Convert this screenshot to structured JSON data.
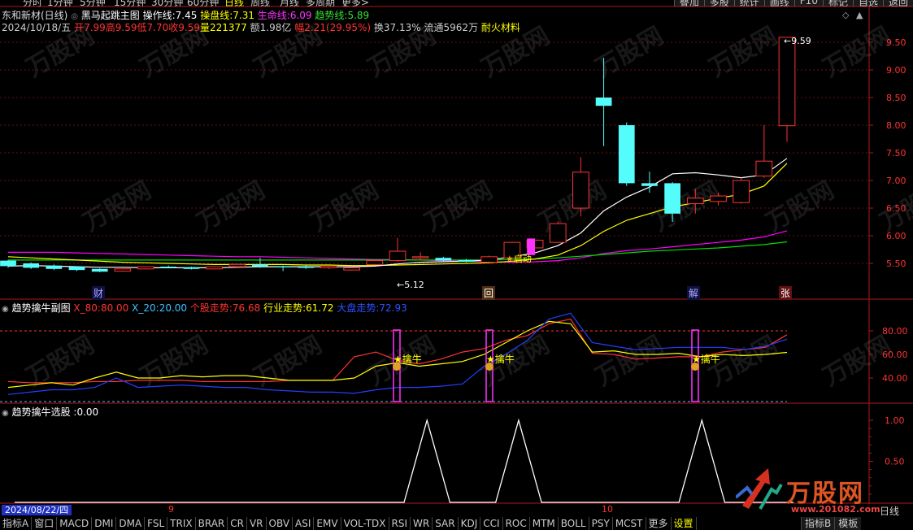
{
  "top_tabs": [
    "分时",
    "1分钟",
    "5分钟",
    "15分钟",
    "30分钟",
    "60分钟",
    "日线",
    "周线",
    "月线",
    "多周期",
    "更多>"
  ],
  "top_active": "日线",
  "top_right_buttons": [
    "叠加",
    "多股",
    "统计",
    "画线",
    "F10",
    "标记",
    "自选",
    "返回"
  ],
  "main_panel": {
    "stock_name": "东和新材(日线)",
    "indicator_name": "黑马起跳主图",
    "op_line_label": "操作线:",
    "op_line_value": "7.45",
    "trade_line_label": "操盘线:",
    "trade_line_value": "7.31",
    "life_line_label": "生命线:",
    "life_line_value": "6.09",
    "trend_line_label": "趋势线:",
    "trend_line_value": "5.89",
    "date": "2024/10/18/五",
    "open_label": "开",
    "open": "7.99",
    "high_label": "高",
    "high": "9.59",
    "low_label": "低",
    "low": "7.70",
    "close_label": "收",
    "close": "9.59",
    "vol_label": "量",
    "vol": "221377",
    "amount_label": "额",
    "amount": "1.98亿",
    "change_label": "幅",
    "change": "2.21(29.95%)",
    "turnover_label": "换",
    "turnover": "37.13%",
    "float_label": "流通",
    "float": "5962万",
    "sector": "耐火材料",
    "high_mark": "9.59",
    "low_mark": "5.12",
    "start_label": "启动",
    "markers": [
      "财",
      "回",
      "解",
      "张"
    ]
  },
  "sub1": {
    "title": "趋势擒牛副图",
    "x80_label": "X_80:",
    "x80": "80.00",
    "x20_label": "X_20:",
    "x20": "20.00",
    "stock_label": "个股走势:",
    "stock": "76.68",
    "industry_label": "行业走势:",
    "industry": "61.72",
    "market_label": "大盘走势:",
    "market": "72.93",
    "signal_label": "擒牛"
  },
  "sub2": {
    "title": "趋势擒牛选股",
    "value_sep": ":",
    "value": "0.00"
  },
  "axes": {
    "main": [
      "9.50",
      "9.00",
      "8.50",
      "8.00",
      "7.50",
      "7.00",
      "6.50",
      "6.00",
      "5.50"
    ],
    "sub1": [
      "80.00",
      "60.00",
      "40.00"
    ],
    "sub2": [
      "1.00",
      "0.50"
    ]
  },
  "time_axis": {
    "start_date": "2024/08/22/四",
    "month1": "9",
    "month2": "10",
    "period": "日线"
  },
  "bottom_tabs": [
    "指标A",
    "窗口",
    "MACD",
    "DMI",
    "DMA",
    "FSL",
    "TRIX",
    "BRAR",
    "CR",
    "VR",
    "OBV",
    "ASI",
    "EMV",
    "VOL-TDX",
    "RSI",
    "WR",
    "SAR",
    "KDJ",
    "CCI",
    "ROC",
    "MTM",
    "BOLL",
    "PSY",
    "MCST",
    "更多",
    "设置"
  ],
  "bottom_active": "设置",
  "bottom_right_tabs": [
    "指标B",
    "模板"
  ],
  "watermark": {
    "brand": "万股网",
    "url": "www.201082.com"
  },
  "colors": {
    "up": "#ff3333",
    "down": "#54fcfc",
    "ma1": "#ffffff",
    "ma2": "#ffff00",
    "ma3": "#ff00ff",
    "ma4": "#00e000"
  },
  "chart_data": [
    {
      "type": "candlestick",
      "title": "黑马起跳主图",
      "ylim": [
        5.1,
        9.8
      ],
      "candles": [
        {
          "o": 5.55,
          "c": 5.45,
          "h": 5.56,
          "l": 5.42
        },
        {
          "o": 5.5,
          "c": 5.42,
          "h": 5.52,
          "l": 5.4
        },
        {
          "o": 5.46,
          "c": 5.4,
          "h": 5.48,
          "l": 5.38
        },
        {
          "o": 5.44,
          "c": 5.38,
          "h": 5.45,
          "l": 5.36
        },
        {
          "o": 5.4,
          "c": 5.35,
          "h": 5.41,
          "l": 5.34
        },
        {
          "o": 5.36,
          "c": 5.4,
          "h": 5.41,
          "l": 5.35
        },
        {
          "o": 5.4,
          "c": 5.44,
          "h": 5.45,
          "l": 5.39
        },
        {
          "o": 5.44,
          "c": 5.42,
          "h": 5.46,
          "l": 5.41
        },
        {
          "o": 5.43,
          "c": 5.4,
          "h": 5.44,
          "l": 5.39
        },
        {
          "o": 5.4,
          "c": 5.44,
          "h": 5.45,
          "l": 5.39
        },
        {
          "o": 5.44,
          "c": 5.48,
          "h": 5.49,
          "l": 5.43
        },
        {
          "o": 5.48,
          "c": 5.44,
          "h": 5.6,
          "l": 5.42
        },
        {
          "o": 5.45,
          "c": 5.44,
          "h": 5.46,
          "l": 5.36
        },
        {
          "o": 5.44,
          "c": 5.42,
          "h": 5.46,
          "l": 5.4
        },
        {
          "o": 5.42,
          "c": 5.45,
          "h": 5.46,
          "l": 5.4
        },
        {
          "o": 5.38,
          "c": 5.42,
          "h": 5.43,
          "l": 5.37
        },
        {
          "o": 5.48,
          "c": 5.55,
          "h": 5.56,
          "l": 5.47
        },
        {
          "o": 5.55,
          "c": 5.72,
          "h": 5.96,
          "l": 5.53
        },
        {
          "o": 5.62,
          "c": 5.62,
          "h": 5.7,
          "l": 5.55
        },
        {
          "o": 5.6,
          "c": 5.55,
          "h": 5.62,
          "l": 5.54
        },
        {
          "o": 5.56,
          "c": 5.53,
          "h": 5.58,
          "l": 5.52
        },
        {
          "o": 5.52,
          "c": 5.62,
          "h": 5.64,
          "l": 5.51
        },
        {
          "o": 5.6,
          "c": 5.88,
          "h": 5.89,
          "l": 5.59
        },
        {
          "o": 5.78,
          "c": 5.92,
          "h": 5.93,
          "l": 5.77
        },
        {
          "o": 5.88,
          "c": 6.22,
          "h": 6.26,
          "l": 5.87
        },
        {
          "o": 6.5,
          "c": 7.15,
          "h": 7.42,
          "l": 6.35
        },
        {
          "o": 8.5,
          "c": 8.35,
          "h": 9.22,
          "l": 7.62
        },
        {
          "o": 8.0,
          "c": 6.95,
          "h": 8.05,
          "l": 6.9
        },
        {
          "o": 6.95,
          "c": 6.9,
          "h": 7.16,
          "l": 6.78
        },
        {
          "o": 6.95,
          "c": 6.4,
          "h": 6.97,
          "l": 6.25
        },
        {
          "o": 6.58,
          "c": 6.68,
          "h": 6.85,
          "l": 6.4
        },
        {
          "o": 6.62,
          "c": 6.72,
          "h": 6.78,
          "l": 6.55
        },
        {
          "o": 6.6,
          "c": 7.0,
          "h": 7.05,
          "l": 6.58
        },
        {
          "o": 7.08,
          "c": 7.35,
          "h": 8.0,
          "l": 7.05
        },
        {
          "o": 7.99,
          "c": 9.59,
          "h": 9.59,
          "l": 7.7
        }
      ],
      "ma_white": [
        5.45,
        5.46,
        5.45,
        5.44,
        5.43,
        5.43,
        5.42,
        5.42,
        5.42,
        5.42,
        5.43,
        5.44,
        5.44,
        5.44,
        5.44,
        5.44,
        5.45,
        5.49,
        5.52,
        5.53,
        5.54,
        5.56,
        5.62,
        5.69,
        5.82,
        6.05,
        6.45,
        6.7,
        6.88,
        7.12,
        7.14,
        7.1,
        7.05,
        7.1,
        7.4
      ],
      "ma_yellow": [
        5.62,
        5.6,
        5.58,
        5.56,
        5.54,
        5.52,
        5.51,
        5.5,
        5.49,
        5.48,
        5.48,
        5.48,
        5.48,
        5.47,
        5.47,
        5.46,
        5.46,
        5.47,
        5.48,
        5.49,
        5.5,
        5.51,
        5.54,
        5.58,
        5.65,
        5.82,
        6.08,
        6.28,
        6.4,
        6.52,
        6.6,
        6.68,
        6.75,
        6.9,
        7.31
      ],
      "ma_magenta": [
        5.7,
        5.7,
        5.7,
        5.69,
        5.68,
        5.67,
        5.66,
        5.65,
        5.64,
        5.63,
        5.62,
        5.62,
        5.61,
        5.6,
        5.59,
        5.58,
        5.57,
        5.57,
        5.56,
        5.55,
        5.54,
        5.53,
        5.52,
        5.53,
        5.55,
        5.6,
        5.68,
        5.73,
        5.76,
        5.8,
        5.84,
        5.88,
        5.92,
        5.98,
        6.09
      ],
      "ma_green": [
        5.56,
        5.56,
        5.56,
        5.56,
        5.56,
        5.56,
        5.56,
        5.56,
        5.56,
        5.56,
        5.56,
        5.56,
        5.56,
        5.56,
        5.56,
        5.56,
        5.56,
        5.56,
        5.56,
        5.56,
        5.56,
        5.56,
        5.57,
        5.58,
        5.6,
        5.63,
        5.66,
        5.69,
        5.72,
        5.74,
        5.76,
        5.78,
        5.81,
        5.84,
        5.89
      ]
    },
    {
      "type": "line",
      "title": "趋势擒牛副图",
      "ylim": [
        20,
        100
      ],
      "x_count": 34,
      "series": [
        {
          "name": "个股走势",
          "color": "#ff3333",
          "values": [
            37,
            36,
            36,
            36,
            37,
            37,
            38,
            38,
            38,
            37,
            37,
            37,
            37,
            38,
            38,
            38,
            58,
            62,
            55,
            52,
            56,
            62,
            65,
            72,
            76,
            86,
            90,
            61,
            60,
            56,
            57,
            58,
            58,
            62,
            64,
            66,
            76.68
          ]
        },
        {
          "name": "行业走势",
          "color": "#ffff00",
          "values": [
            32,
            34,
            36,
            34,
            40,
            45,
            40,
            40,
            42,
            41,
            42,
            42,
            40,
            38,
            38,
            38,
            40,
            50,
            53,
            50,
            52,
            54,
            60,
            70,
            80,
            88,
            86,
            62,
            63,
            60,
            60,
            61,
            58,
            60,
            59,
            60,
            61.72
          ]
        },
        {
          "name": "大盘走势",
          "color": "#2040ff",
          "values": [
            26,
            28,
            30,
            30,
            32,
            40,
            32,
            33,
            34,
            33,
            32,
            32,
            30,
            29,
            28,
            28,
            27,
            30,
            32,
            32,
            33,
            35,
            50,
            60,
            72,
            90,
            95,
            70,
            67,
            64,
            65,
            66,
            66,
            66,
            64,
            67,
            72.93
          ]
        }
      ],
      "signals": [
        17,
        21,
        30
      ]
    },
    {
      "type": "line",
      "title": "趋势擒牛选股",
      "ylim": [
        0,
        1.1
      ],
      "x_count": 34,
      "series": [
        {
          "name": "趋势擒牛选股",
          "color": "#ffffff",
          "values": [
            0,
            0,
            0,
            0,
            0,
            0,
            0,
            0,
            0,
            0,
            0,
            0,
            0,
            0,
            0,
            0,
            0,
            0,
            1,
            0,
            0,
            0,
            1,
            0,
            0,
            0,
            0,
            0,
            0,
            0,
            1,
            0,
            0,
            0,
            0
          ]
        }
      ]
    }
  ]
}
